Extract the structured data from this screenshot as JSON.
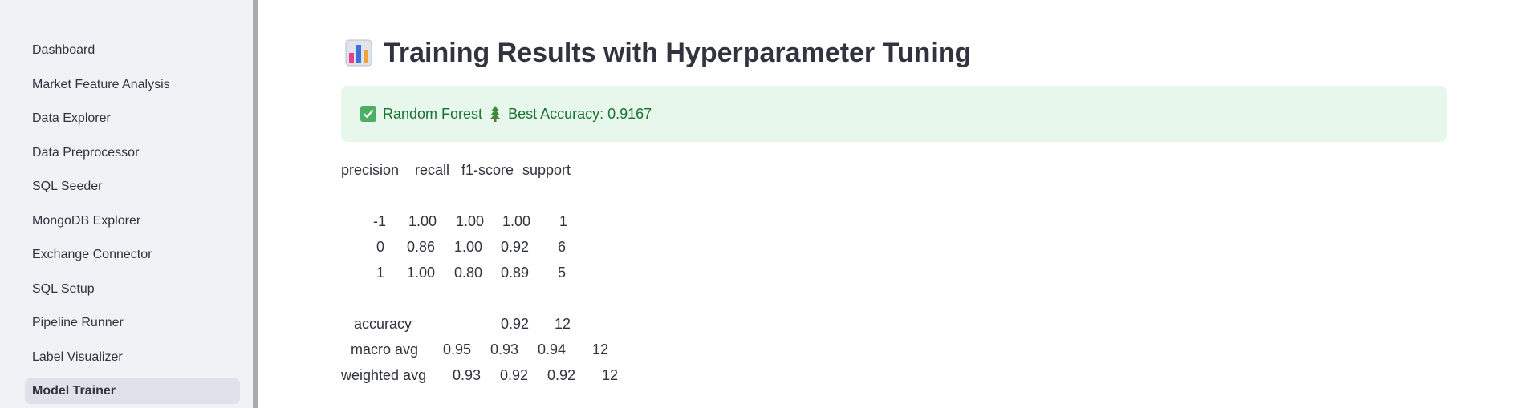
{
  "sidebar": {
    "items": [
      {
        "label": "Dashboard",
        "active": false
      },
      {
        "label": "Market Feature Analysis",
        "active": false
      },
      {
        "label": "Data Explorer",
        "active": false
      },
      {
        "label": "Data Preprocessor",
        "active": false
      },
      {
        "label": "SQL Seeder",
        "active": false
      },
      {
        "label": "MongoDB Explorer",
        "active": false
      },
      {
        "label": "Exchange Connector",
        "active": false
      },
      {
        "label": "SQL Setup",
        "active": false
      },
      {
        "label": "Pipeline Runner",
        "active": false
      },
      {
        "label": "Label Visualizer",
        "active": false
      },
      {
        "label": "Model Trainer",
        "active": true
      }
    ]
  },
  "main": {
    "title_icon": "bar-chart-icon",
    "title": "Training Results with Hyperparameter Tuning",
    "alert": {
      "check_icon": "check-mark-icon",
      "model_text": "Random Forest",
      "tree_icon": "evergreen-tree-icon",
      "accuracy_text": "Best Accuracy: 0.9167"
    },
    "report": {
      "headers": [
        "precision",
        "recall",
        "f1-score",
        "support"
      ],
      "rows": [
        {
          "label": "-1",
          "precision": "1.00",
          "recall": "1.00",
          "f1": "1.00",
          "support": "1"
        },
        {
          "label": "0",
          "precision": "0.86",
          "recall": "1.00",
          "f1": "0.92",
          "support": "6"
        },
        {
          "label": "1",
          "precision": "1.00",
          "recall": "0.80",
          "f1": "0.89",
          "support": "5"
        }
      ],
      "accuracy": {
        "label": "accuracy",
        "value": "0.92",
        "support": "12"
      },
      "macro_avg": {
        "label": "macro avg",
        "precision": "0.95",
        "recall": "0.93",
        "f1": "0.94",
        "support": "12"
      },
      "weighted_avg": {
        "label": "weighted avg",
        "precision": "0.93",
        "recall": "0.92",
        "f1": "0.92",
        "support": "12"
      }
    }
  },
  "colors": {
    "sidebar_bg": "#f0f2f6",
    "active_item_bg": "#dfe2ea",
    "alert_bg": "#e8f7ec",
    "alert_text": "#177233",
    "text": "#31333f"
  }
}
